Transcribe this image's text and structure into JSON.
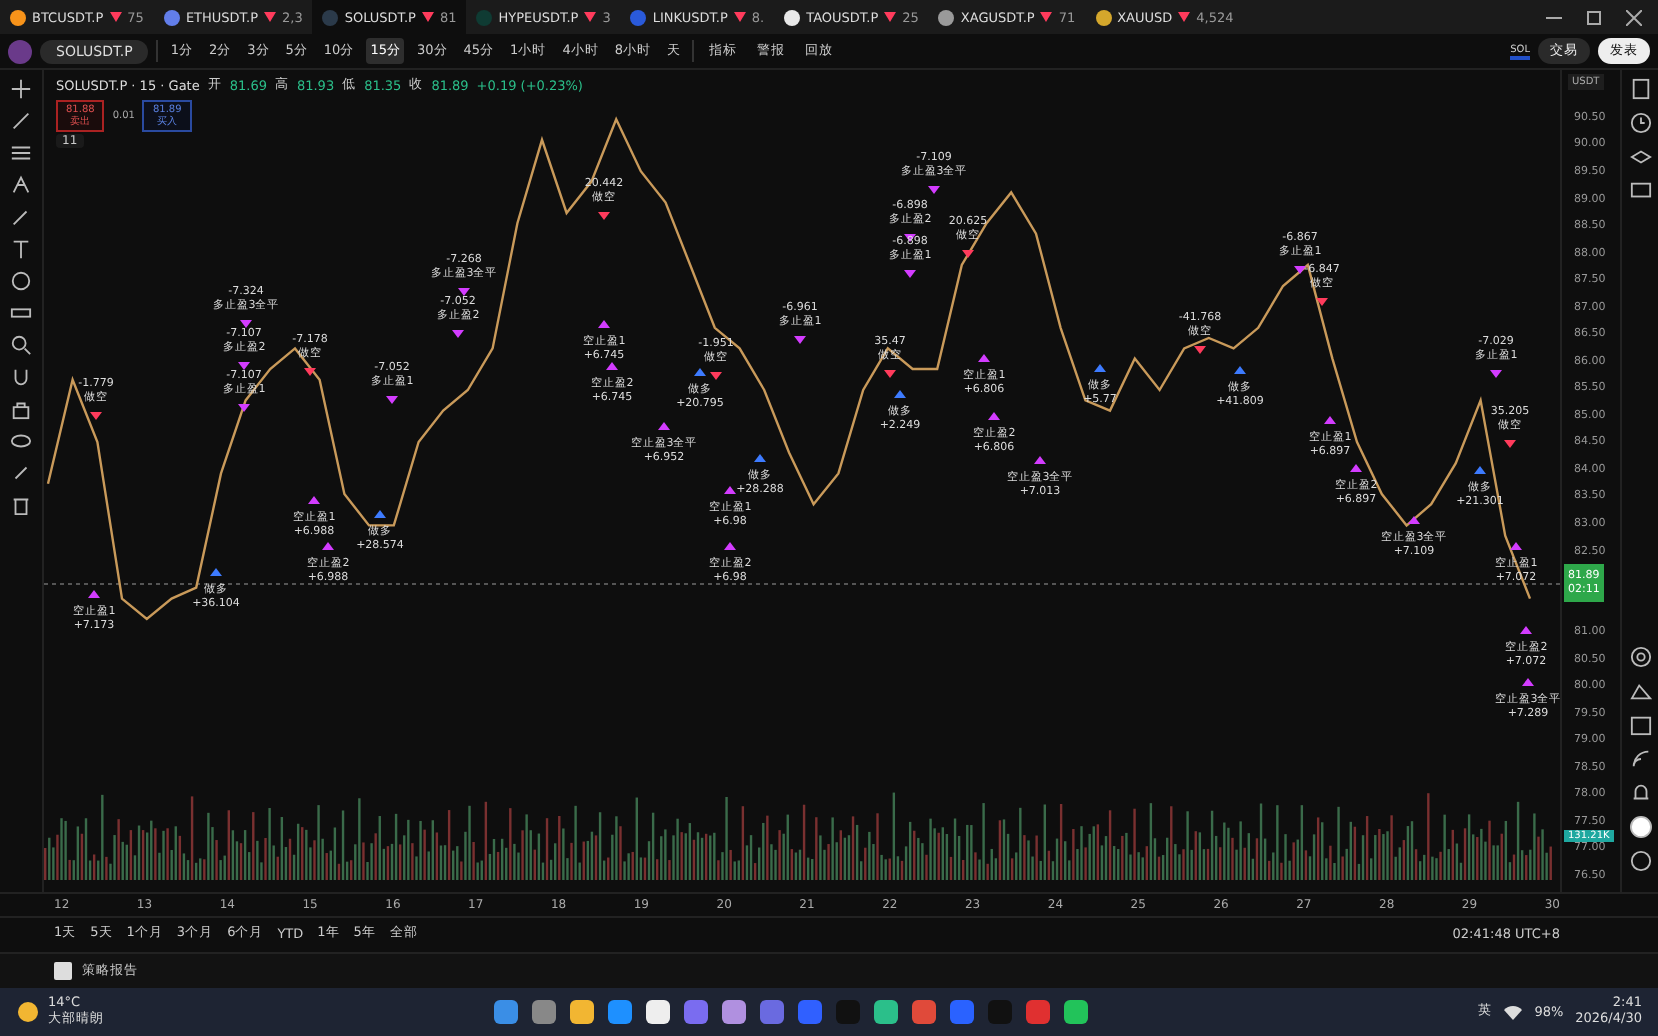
{
  "tabs": [
    {
      "symbol": "BTCUSDT.P",
      "price": "75",
      "color": "#f7931a",
      "selected": false
    },
    {
      "symbol": "ETHUSDT.P",
      "price": "2,3",
      "color": "#627eea",
      "selected": false
    },
    {
      "symbol": "SOLUSDT.P",
      "price": "81",
      "color": "#2b3a4a",
      "selected": true
    },
    {
      "symbol": "HYPEUSDT.P",
      "price": "3",
      "color": "#0f3b33",
      "selected": false
    },
    {
      "symbol": "LINKUSDT.P",
      "price": "8.",
      "color": "#2a5ada",
      "selected": false
    },
    {
      "symbol": "TAOUSDT.P",
      "price": "25",
      "color": "#e8e8e8",
      "selected": false
    },
    {
      "symbol": "XAGUSDT.P",
      "price": "71",
      "color": "#9a9a9a",
      "selected": false
    },
    {
      "symbol": "XAUUSD",
      "price": "4,524",
      "color": "#d4a72c",
      "selected": false
    }
  ],
  "toolbar": {
    "symbol": "SOLUSDT.P",
    "intervals": [
      {
        "label": "1分",
        "selected": false
      },
      {
        "label": "2分",
        "selected": false
      },
      {
        "label": "3分",
        "selected": false
      },
      {
        "label": "5分",
        "selected": false
      },
      {
        "label": "10分",
        "selected": false
      },
      {
        "label": "15分",
        "selected": true
      },
      {
        "label": "30分",
        "selected": false
      },
      {
        "label": "45分",
        "selected": false
      },
      {
        "label": "1小时",
        "selected": false
      },
      {
        "label": "4小时",
        "selected": false
      },
      {
        "label": "8小时",
        "selected": false
      },
      {
        "label": "天",
        "selected": false
      }
    ],
    "indicators": "指标",
    "alert": "警报",
    "replay": "回放",
    "currency_badge": "SOL",
    "trade": "交易",
    "publish": "发表"
  },
  "legend": {
    "title": "SOLUSDT.P · 15 · Gate",
    "ohlc": [
      {
        "label": "开",
        "value": "81.69"
      },
      {
        "label": "高",
        "value": "81.93"
      },
      {
        "label": "低",
        "value": "81.35"
      },
      {
        "label": "收",
        "value": "81.89"
      }
    ],
    "change": "+0.19 (+0.23%)",
    "sell_price": "81.88",
    "sell_label": "卖出",
    "spread": "0.01",
    "buy_price": "81.89",
    "buy_label": "买入",
    "collapse_count": "11"
  },
  "chart_data": {
    "type": "line",
    "ylim": [
      76.21,
      91.39
    ],
    "yticks": [
      {
        "value": 90.5,
        "label": "90.50"
      },
      {
        "value": 90,
        "label": "90.00"
      },
      {
        "value": 89.5,
        "label": "89.50"
      },
      {
        "value": 89,
        "label": "89.00"
      },
      {
        "value": 88.5,
        "label": "88.50"
      },
      {
        "value": 88,
        "label": "88.00"
      },
      {
        "value": 87.5,
        "label": "87.50"
      },
      {
        "value": 87,
        "label": "87.00"
      },
      {
        "value": 86.5,
        "label": "86.50"
      },
      {
        "value": 86,
        "label": "86.00"
      },
      {
        "value": 85.5,
        "label": "85.50"
      },
      {
        "value": 85,
        "label": "85.00"
      },
      {
        "value": 84.5,
        "label": "84.50"
      },
      {
        "value": 84,
        "label": "84.00"
      },
      {
        "value": 83.5,
        "label": "83.50"
      },
      {
        "value": 83,
        "label": "83.00"
      },
      {
        "value": 82.5,
        "label": "82.50"
      },
      {
        "value": 81,
        "label": "81.00"
      },
      {
        "value": 80.5,
        "label": "80.50"
      },
      {
        "value": 80,
        "label": "80.00"
      },
      {
        "value": 79.5,
        "label": "79.50"
      },
      {
        "value": 79,
        "label": "79.00"
      },
      {
        "value": 78.5,
        "label": "78.50"
      },
      {
        "value": 78,
        "label": "78.00"
      },
      {
        "value": 77.5,
        "label": "77.50"
      },
      {
        "value": 77,
        "label": "77.00"
      },
      {
        "value": 76.5,
        "label": "76.50"
      }
    ],
    "series": [
      {
        "color": "#c99a5a",
        "values": [
          83.75,
          85.67,
          84.52,
          81.63,
          81.25,
          81.63,
          81.83,
          83.94,
          85.29,
          85.87,
          86.25,
          85.67,
          83.56,
          82.98,
          82.98,
          84.52,
          85.1,
          85.48,
          86.25,
          88.56,
          90.1,
          88.75,
          89.33,
          90.48,
          89.52,
          88.94,
          87.79,
          86.63,
          86.25,
          85.48,
          84.33,
          83.37,
          83.94,
          85.48,
          86.25,
          85.87,
          85.87,
          87.79,
          88.56,
          89.13,
          88.37,
          86.63,
          85.29,
          85.1,
          86.06,
          85.48,
          86.25,
          86.44,
          86.25,
          86.63,
          87.4,
          87.79,
          86.06,
          84.52,
          83.56,
          82.98,
          83.37,
          84.13,
          85.29,
          82.79,
          81.63
        ]
      }
    ]
  },
  "annotations": [
    {
      "kind": "long_tp",
      "lines": [
        "-7.109",
        "多止盈3全平"
      ]
    },
    {
      "kind": "short_entry",
      "lines": [
        "20.442",
        "做空"
      ]
    },
    {
      "kind": "long_tp",
      "lines": [
        "-6.898",
        "多止盈2"
      ]
    },
    {
      "kind": "short_entry",
      "lines": [
        "20.625",
        "做空"
      ]
    },
    {
      "kind": "long_tp",
      "lines": [
        "-6.898",
        "多止盈1"
      ]
    },
    {
      "kind": "long_tp",
      "lines": [
        "-6.867",
        "多止盈1"
      ]
    },
    {
      "kind": "long_tp",
      "lines": [
        "-7.268",
        "多止盈3全平"
      ]
    },
    {
      "kind": "short_entry",
      "lines": [
        "-6.847",
        "做空"
      ]
    },
    {
      "kind": "long_tp",
      "lines": [
        "-7.324",
        "多止盈3全平"
      ]
    },
    {
      "kind": "long_tp",
      "lines": [
        "-7.052",
        "多止盈2"
      ]
    },
    {
      "kind": "long_tp",
      "lines": [
        "-6.961",
        "多止盈1"
      ]
    },
    {
      "kind": "long_tp",
      "lines": [
        "-7.107",
        "多止盈2"
      ]
    },
    {
      "kind": "short_entry",
      "lines": [
        "-41.768",
        "做空"
      ]
    },
    {
      "kind": "short_entry",
      "lines": [
        "-7.178",
        "做空"
      ]
    },
    {
      "kind": "short_tp",
      "lines": [
        "空止盈1",
        "+6.745"
      ]
    },
    {
      "kind": "short_entry",
      "lines": [
        "-1.951",
        "做空"
      ]
    },
    {
      "kind": "short_entry",
      "lines": [
        "35.47",
        "做空"
      ]
    },
    {
      "kind": "long_tp",
      "lines": [
        "-7.029",
        "多止盈1"
      ]
    },
    {
      "kind": "short_entry",
      "lines": [
        "-1.779",
        "做空"
      ]
    },
    {
      "kind": "long_tp",
      "lines": [
        "-7.107",
        "多止盈1"
      ]
    },
    {
      "kind": "long_tp",
      "lines": [
        "-7.052",
        "多止盈1"
      ]
    },
    {
      "kind": "short_tp",
      "lines": [
        "空止盈2",
        "+6.745"
      ]
    },
    {
      "kind": "long_entry",
      "lines": [
        "做多",
        "+20.795"
      ]
    },
    {
      "kind": "short_tp",
      "lines": [
        "空止盈1",
        "+6.806"
      ]
    },
    {
      "kind": "long_entry",
      "lines": [
        "做多",
        "+5.77"
      ]
    },
    {
      "kind": "long_entry",
      "lines": [
        "做多",
        "+41.809"
      ]
    },
    {
      "kind": "long_entry",
      "lines": [
        "做多",
        "+2.249"
      ]
    },
    {
      "kind": "short_entry",
      "lines": [
        "35.205",
        "做空"
      ]
    },
    {
      "kind": "short_tp",
      "lines": [
        "空止盈3全平",
        "+6.952"
      ]
    },
    {
      "kind": "short_tp",
      "lines": [
        "空止盈2",
        "+6.806"
      ]
    },
    {
      "kind": "short_tp",
      "lines": [
        "空止盈1",
        "+6.897"
      ]
    },
    {
      "kind": "long_entry",
      "lines": [
        "做多",
        "+28.288"
      ]
    },
    {
      "kind": "short_tp",
      "lines": [
        "空止盈3全平",
        "+7.013"
      ]
    },
    {
      "kind": "short_tp",
      "lines": [
        "空止盈2",
        "+6.897"
      ]
    },
    {
      "kind": "long_entry",
      "lines": [
        "做多",
        "+21.301"
      ]
    },
    {
      "kind": "short_tp",
      "lines": [
        "空止盈1",
        "+6.988"
      ]
    },
    {
      "kind": "short_tp",
      "lines": [
        "空止盈1",
        "+6.98"
      ]
    },
    {
      "kind": "long_entry",
      "lines": [
        "做多",
        "+28.574"
      ]
    },
    {
      "kind": "short_tp",
      "lines": [
        "空止盈3全平",
        "+7.109"
      ]
    },
    {
      "kind": "short_tp",
      "lines": [
        "空止盈2",
        "+6.988"
      ]
    },
    {
      "kind": "short_tp",
      "lines": [
        "空止盈2",
        "+6.98"
      ]
    },
    {
      "kind": "short_tp",
      "lines": [
        "空止盈1",
        "+7.072"
      ]
    },
    {
      "kind": "long_entry",
      "lines": [
        "做多",
        "+36.104"
      ]
    },
    {
      "kind": "short_tp",
      "lines": [
        "空止盈1",
        "+7.173"
      ]
    },
    {
      "kind": "short_tp",
      "lines": [
        "空止盈2",
        "+7.072"
      ]
    },
    {
      "kind": "short_tp",
      "lines": [
        "空止盈3全平",
        "+7.289"
      ]
    }
  ],
  "price_axis": {
    "currency": "USDT",
    "last_price": "81.89",
    "countdown": "02:11",
    "volume": "131.21K"
  },
  "time_axis": [
    "12",
    "13",
    "14",
    "15",
    "16",
    "17",
    "18",
    "19",
    "20",
    "21",
    "22",
    "23",
    "24",
    "25",
    "26",
    "27",
    "28",
    "29",
    "30"
  ],
  "ranges": [
    "1天",
    "5天",
    "1个月",
    "3个月",
    "6个月",
    "YTD",
    "1年",
    "5年",
    "全部"
  ],
  "clock": "02:41:48 UTC+8",
  "strategy_report": "策略报告",
  "taskbar": {
    "temperature": "14°C",
    "weather": "大部晴朗",
    "ime": "英",
    "battery": "98%",
    "time": "2:41",
    "date": "2026/4/30"
  }
}
